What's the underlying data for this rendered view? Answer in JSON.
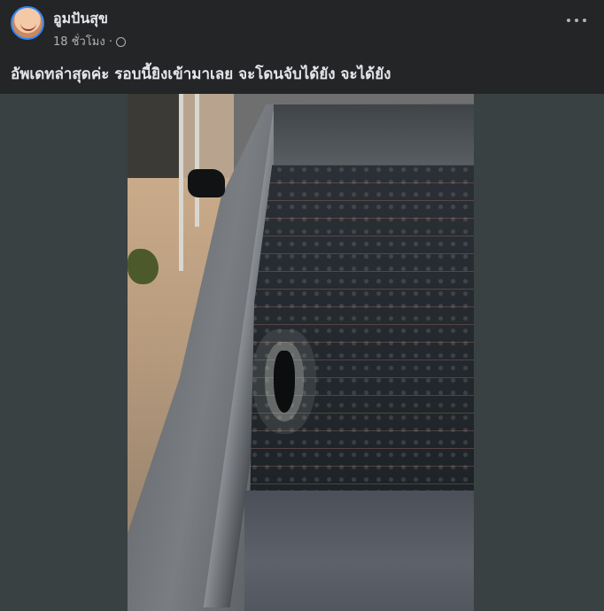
{
  "post": {
    "author": "อูมปันสุข",
    "timestamp": "18 ชั่วโมง ·",
    "privacy_icon": "globe-icon",
    "caption": "อัพเดทล่าสุดค่ะ รอบนี้ยิงเข้ามาเลย จะโดนจับได้ยัง จะได้ยัง",
    "more_icon": "more-options-icon"
  },
  "colors": {
    "background": "#242526",
    "media_background": "#394143",
    "text_primary": "#e4e6eb",
    "text_secondary": "#b0b3b8",
    "avatar_ring": "#2d88ff"
  }
}
